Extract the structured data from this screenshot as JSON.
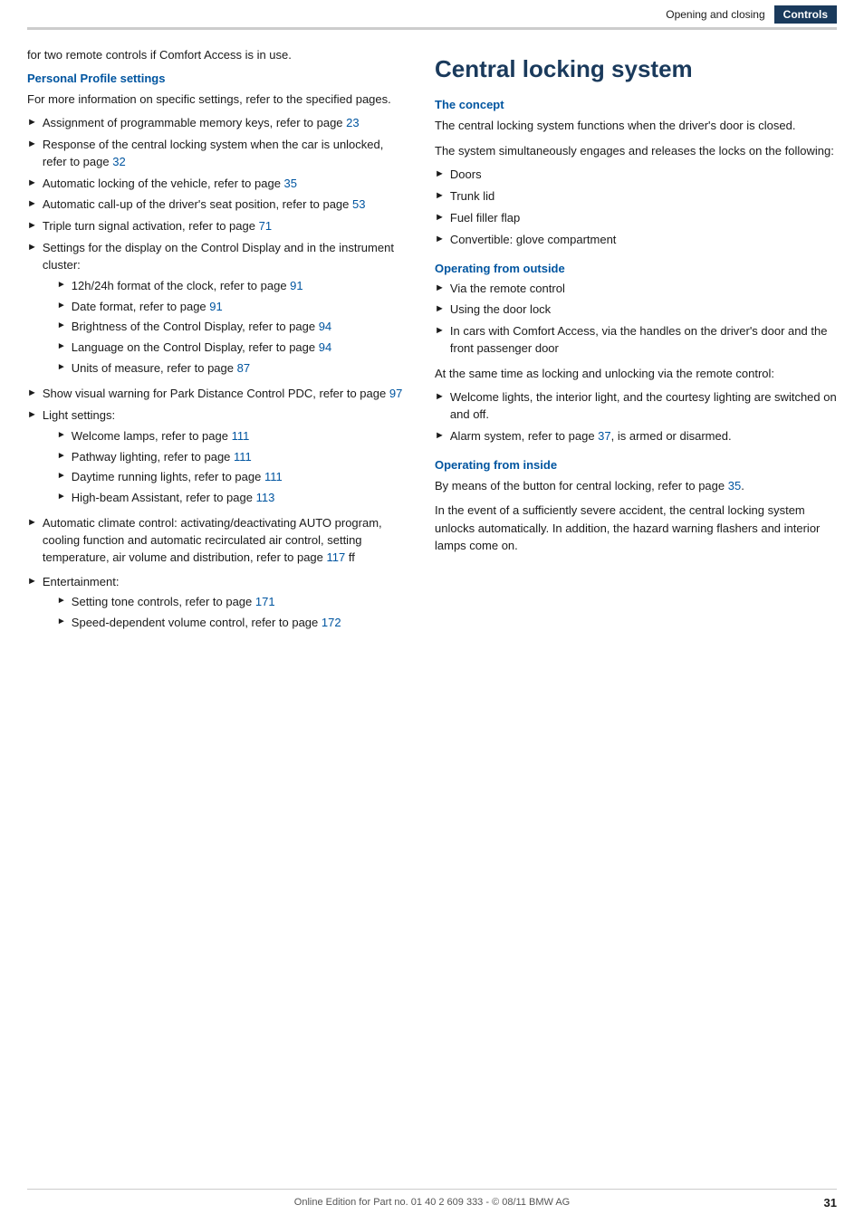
{
  "header": {
    "nav_items": [
      {
        "label": "Opening and closing",
        "active": false
      },
      {
        "label": "Controls",
        "active": true
      }
    ]
  },
  "footer": {
    "copyright": "Online Edition for Part no. 01 40 2 609 333 - © 08/11 BMW AG",
    "page_number": "31"
  },
  "left_column": {
    "intro_text": "for two remote controls if Comfort Access is in use.",
    "personal_profile": {
      "heading": "Personal Profile settings",
      "intro": "For more information on specific settings, refer to the specified pages.",
      "items": [
        {
          "text": "Assignment of programmable memory keys, refer to page ",
          "link": "23",
          "link_page": "23"
        },
        {
          "text": "Response of the central locking system when the car is unlocked, refer to page ",
          "link": "32",
          "link_page": "32"
        },
        {
          "text": "Automatic locking of the vehicle, refer to page ",
          "link": "35",
          "link_page": "35"
        },
        {
          "text": "Automatic call-up of the driver's seat position, refer to page ",
          "link": "53",
          "link_page": "53"
        },
        {
          "text": "Triple turn signal activation, refer to page ",
          "link": "71",
          "link_page": "71"
        },
        {
          "text": "Settings for the display on the Control Display and in the instrument cluster:",
          "subitems": [
            {
              "text": "12h/24h format of the clock, refer to page ",
              "link": "91"
            },
            {
              "text": "Date format, refer to page ",
              "link": "91"
            },
            {
              "text": "Brightness of the Control Display, refer to page ",
              "link": "94"
            },
            {
              "text": "Language on the Control Display, refer to page ",
              "link": "94"
            },
            {
              "text": "Units of measure, refer to page ",
              "link": "87"
            }
          ]
        },
        {
          "text": "Show visual warning for Park Distance Control PDC, refer to page ",
          "link": "97",
          "link_page": "97"
        },
        {
          "text": "Light settings:",
          "subitems": [
            {
              "text": "Welcome lamps, refer to page ",
              "link": "111"
            },
            {
              "text": "Pathway lighting, refer to page ",
              "link": "111"
            },
            {
              "text": "Daytime running lights, refer to page ",
              "link": "111"
            },
            {
              "text": "High-beam Assistant, refer to page ",
              "link": "113"
            }
          ]
        },
        {
          "text": "Automatic climate control: activating/deactivating AUTO program, cooling function and automatic recirculated air control, setting temperature, air volume and distribution, refer to page ",
          "link": "117",
          "link_suffix": " ff"
        }
      ]
    },
    "entertainment": {
      "heading": "Entertainment:",
      "subitems": [
        {
          "text": "Setting tone controls, refer to page ",
          "link": "171"
        },
        {
          "text": "Speed-dependent volume control, refer to page ",
          "link": "172"
        }
      ]
    }
  },
  "right_column": {
    "main_heading": "Central locking system",
    "concept": {
      "heading": "The concept",
      "para1": "The central locking system functions when the driver's door is closed.",
      "para2": "The system simultaneously engages and releases the locks on the following:",
      "items": [
        "Doors",
        "Trunk lid",
        "Fuel filler flap",
        "Convertible: glove compartment"
      ]
    },
    "operating_outside": {
      "heading": "Operating from outside",
      "items": [
        "Via the remote control",
        "Using the door lock",
        "In cars with Comfort Access, via the handles on the driver's door and the front passenger door"
      ],
      "para1": "At the same time as locking and unlocking via the remote control:",
      "subitems": [
        "Welcome lights, the interior light, and the courtesy lighting are switched on and off.",
        {
          "text": "Alarm system, refer to page ",
          "link": "37",
          "suffix": ", is armed or disarmed."
        }
      ]
    },
    "operating_inside": {
      "heading": "Operating from inside",
      "para1_prefix": "By means of the button for central locking, refer to page ",
      "para1_link": "35",
      "para1_suffix": ".",
      "para2": "In the event of a sufficiently severe accident, the central locking system unlocks automatically. In addition, the hazard warning flashers and interior lamps come on."
    }
  }
}
